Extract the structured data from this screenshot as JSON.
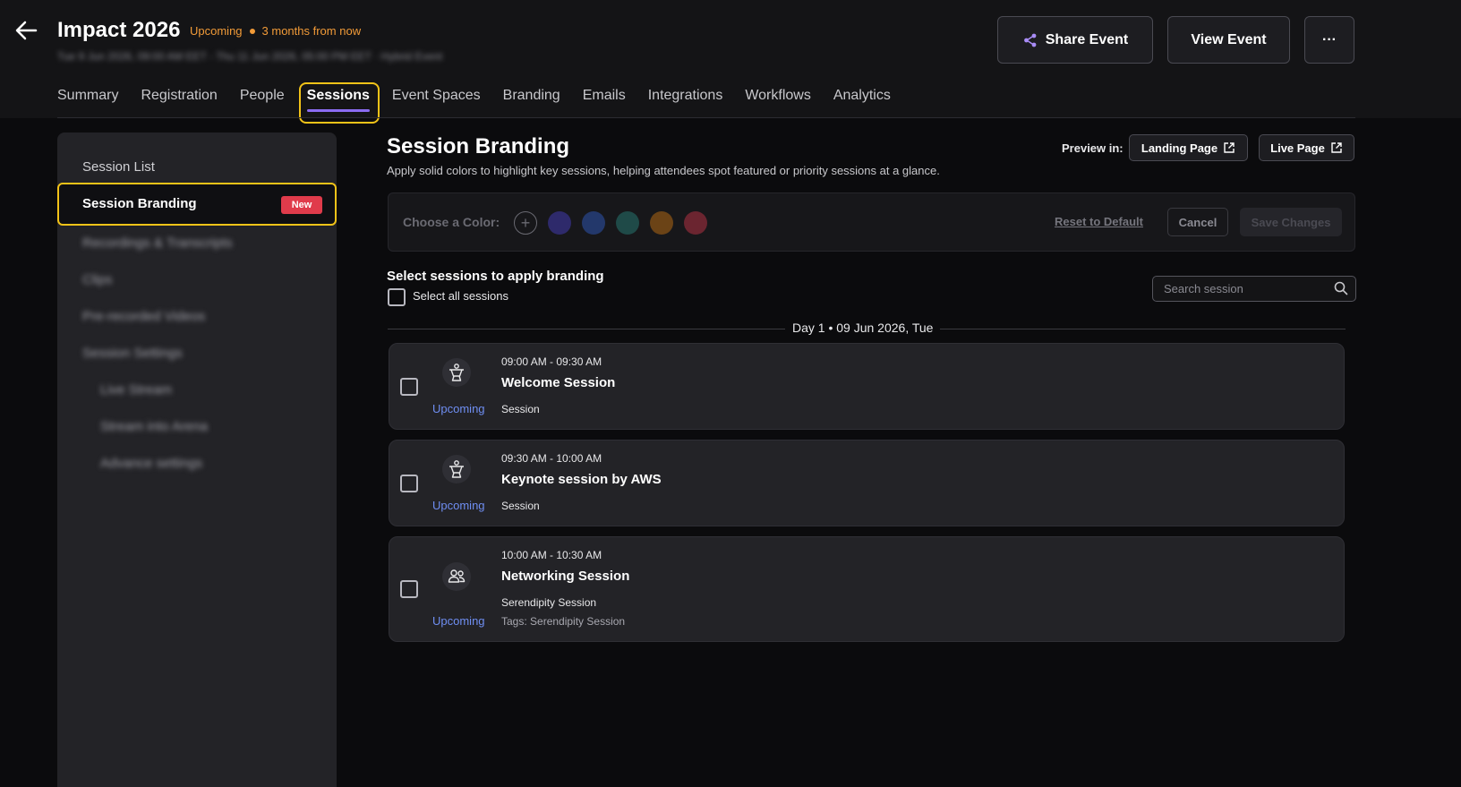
{
  "header": {
    "title": "Impact 2026",
    "status": "Upcoming",
    "relative_time": "3 months from now",
    "dates": "Tue 9 Jun 2026, 09:00 AM EET - Thu 11 Jun 2026, 05:00 PM EET · Hybrid Event",
    "share_label": "Share Event",
    "view_label": "View Event",
    "more_label": "···"
  },
  "tabs": [
    {
      "label": "Summary"
    },
    {
      "label": "Registration"
    },
    {
      "label": "People"
    },
    {
      "label": "Sessions"
    },
    {
      "label": "Event Spaces"
    },
    {
      "label": "Branding"
    },
    {
      "label": "Emails"
    },
    {
      "label": "Integrations"
    },
    {
      "label": "Workflows"
    },
    {
      "label": "Analytics"
    }
  ],
  "sidebar": {
    "session_list": "Session List",
    "active_label": "Session Branding",
    "new_badge": "New",
    "blurred": [
      "Recordings & Transcripts",
      "Clips",
      "Pre-recorded Videos",
      "Session Settings",
      "Live Stream",
      "Stream into Arena",
      "Advance settings"
    ]
  },
  "main": {
    "title": "Session Branding",
    "subtitle": "Apply solid colors to highlight key sessions, helping attendees spot featured or priority sessions at a glance.",
    "preview_label": "Preview in:",
    "landing_label": "Landing Page",
    "live_label": "Live Page",
    "choose_color": "Choose a Color:",
    "reset_label": "Reset to Default",
    "cancel_label": "Cancel",
    "save_label": "Save Changes",
    "select_title": "Select sessions to apply branding",
    "select_all": "Select all sessions",
    "search_placeholder": "Search session",
    "day_label": "Day 1 • 09 Jun 2026, Tue",
    "sessions": [
      {
        "time": "09:00 AM - 09:30 AM",
        "name": "Welcome Session",
        "type": "Session",
        "status": "Upcoming",
        "tags": "",
        "icon": "speaker-icon"
      },
      {
        "time": "09:30 AM - 10:00 AM",
        "name": "Keynote session by AWS",
        "type": "Session",
        "status": "Upcoming",
        "tags": "",
        "icon": "speaker-icon"
      },
      {
        "time": "10:00 AM - 10:30 AM",
        "name": "Networking Session",
        "type": "Serendipity Session",
        "status": "Upcoming",
        "tags": "Tags: Serendipity Session",
        "icon": "people-icon"
      }
    ]
  },
  "colors": {
    "accent": "#8b6cf2",
    "highlight": "#f2c318",
    "upcoming_orange": "#f29b38",
    "upcoming_blue": "#6f8ef2",
    "badge_red": "#e03b4b",
    "swatches": [
      "#2e2a6b",
      "#23386b",
      "#1f4a48",
      "#6b4316",
      "#6b2530"
    ]
  }
}
